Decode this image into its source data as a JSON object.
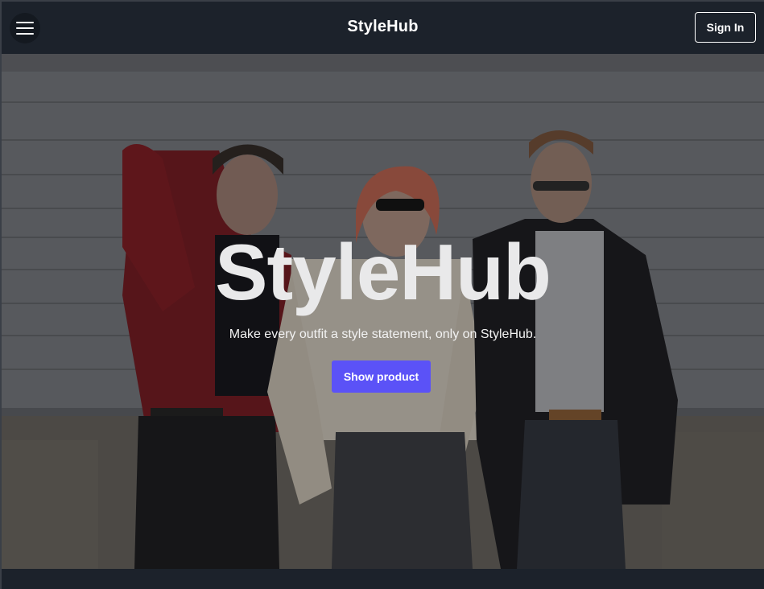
{
  "navbar": {
    "menu_icon": "hamburger-menu-icon",
    "brand": "StyleHub",
    "signin_label": "Sign In"
  },
  "hero": {
    "title": "StyleHub",
    "subtitle": "Make every outfit a style statement, only on StyleHub.",
    "cta_label": "Show product",
    "image": "three-people-fashion-photo"
  },
  "colors": {
    "nav_bg": "#1c222b",
    "cta_bg": "#5b52f7",
    "text": "#ffffff"
  }
}
